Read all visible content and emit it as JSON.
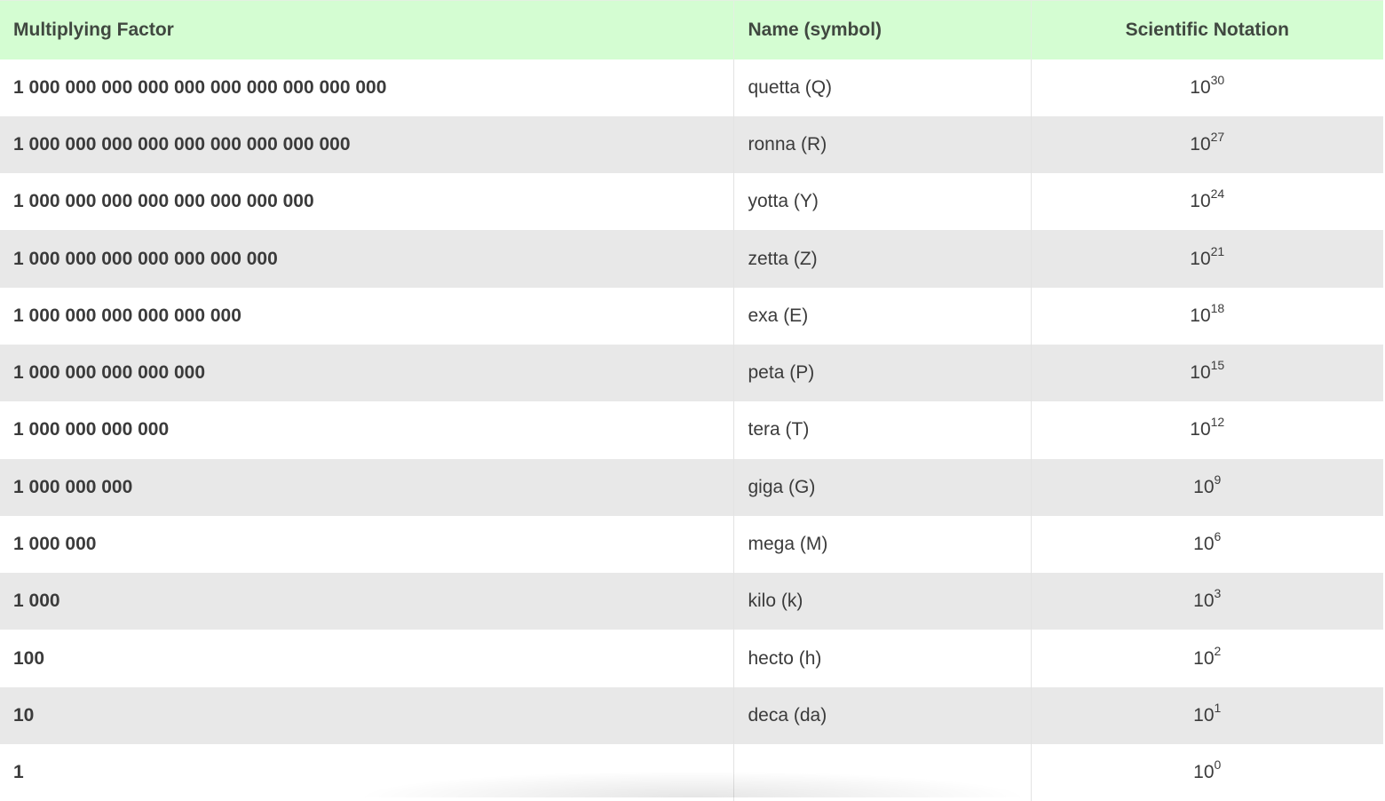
{
  "table": {
    "headers": {
      "factor": "Multiplying Factor",
      "name": "Name (symbol)",
      "scientific": "Scientific Notation"
    },
    "rows": [
      {
        "factor": "1 000 000 000 000 000 000 000 000 000 000",
        "name": "quetta (Q)",
        "base": "10",
        "exponent": "30"
      },
      {
        "factor": "1 000 000 000 000 000 000 000 000 000",
        "name": "ronna (R)",
        "base": "10",
        "exponent": "27"
      },
      {
        "factor": "1 000 000 000 000 000 000 000 000",
        "name": "yotta (Y)",
        "base": "10",
        "exponent": "24"
      },
      {
        "factor": "1 000 000 000 000 000 000 000",
        "name": "zetta (Z)",
        "base": "10",
        "exponent": "21"
      },
      {
        "factor": "1 000 000 000 000 000 000",
        "name": "exa (E)",
        "base": "10",
        "exponent": "18"
      },
      {
        "factor": "1 000 000 000 000 000",
        "name": "peta (P)",
        "base": "10",
        "exponent": "15"
      },
      {
        "factor": "1 000 000 000 000",
        "name": "tera (T)",
        "base": "10",
        "exponent": "12"
      },
      {
        "factor": "1 000 000 000",
        "name": "giga (G)",
        "base": "10",
        "exponent": "9"
      },
      {
        "factor": "1 000 000",
        "name": "mega (M)",
        "base": "10",
        "exponent": "6"
      },
      {
        "factor": "1 000",
        "name": "kilo (k)",
        "base": "10",
        "exponent": "3"
      },
      {
        "factor": "100",
        "name": "hecto (h)",
        "base": "10",
        "exponent": "2"
      },
      {
        "factor": "10",
        "name": "deca (da)",
        "base": "10",
        "exponent": "1"
      },
      {
        "factor": "1",
        "name": "",
        "base": "10",
        "exponent": "0"
      }
    ]
  },
  "colors": {
    "header_background": "#d4fdd2",
    "row_even_background": "#e8e8e8",
    "row_odd_background": "#ffffff",
    "text": "#3b3b3b"
  }
}
